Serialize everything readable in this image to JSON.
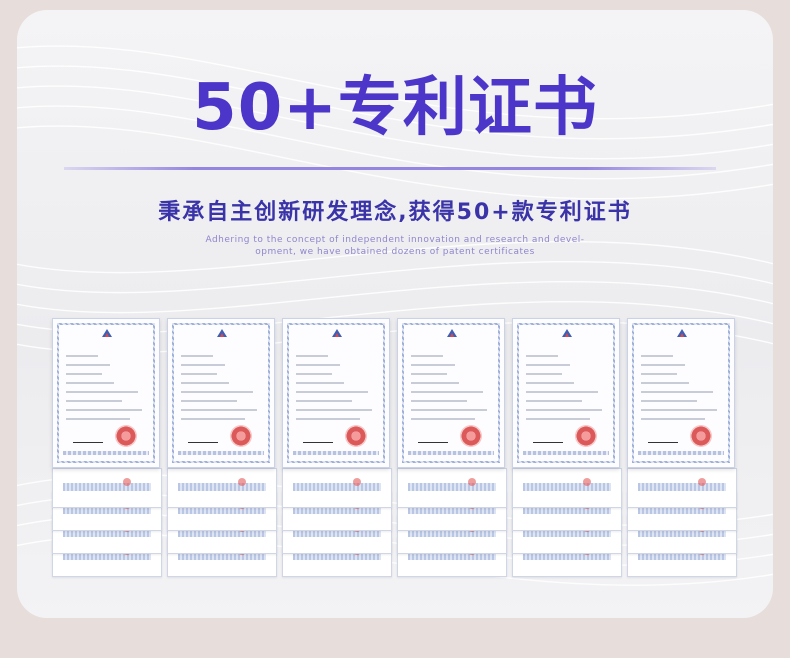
{
  "header": {
    "title": "50+专利证书",
    "subtitle": "秉承自主创新研发理念,获得50+款专利证书",
    "english_line1": "Adhering to the concept of independent innovation and research and devel-",
    "english_line2": "opment, we have obtained dozens of patent certificates"
  },
  "certificates": {
    "count_shown": 6,
    "stacked_sheets_per_column": 4
  },
  "colors": {
    "title": "#4b36c9",
    "subtitle": "#3a34a8",
    "english": "#8e86cc",
    "divider": "#9486e0",
    "page_background": "#e7dedb",
    "card_background": "#f0f0f2",
    "seal": "#d63c3c"
  }
}
